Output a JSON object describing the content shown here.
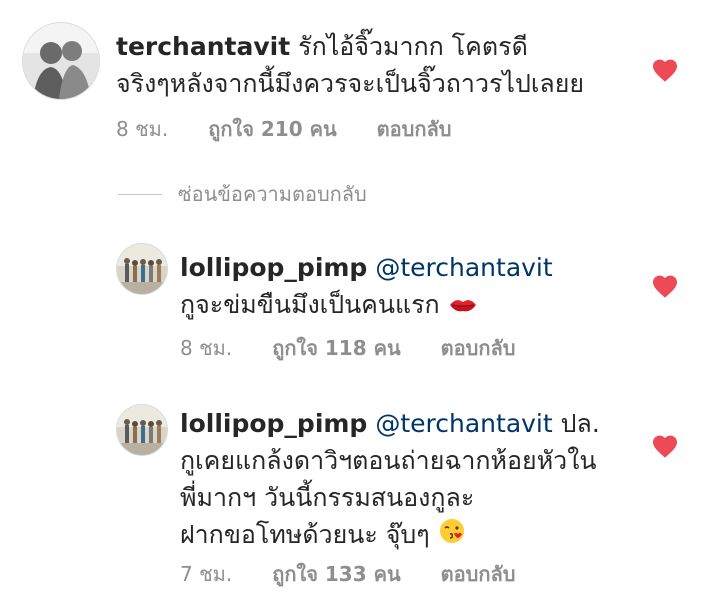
{
  "comments": [
    {
      "username": "terchantavit",
      "text_line1": "รักไอ้จิ๊วมากก โคตรดี",
      "text_line2": "จริงๆหลังจากนี้มึงควรจะเป็นจิ๊วถาวรไปเลยย",
      "time": "8 ชม.",
      "likes": "ถูกใจ 210 คน",
      "reply_label": "ตอบกลับ"
    },
    {
      "username": "lollipop_pimp",
      "mention": "@terchantavit",
      "text_line2": "กูจะข่มขืนมึงเป็นคนแรก",
      "emoji": "kiss-mark",
      "time": "8 ชม.",
      "likes": "ถูกใจ 118 คน",
      "reply_label": "ตอบกลับ"
    },
    {
      "username": "lollipop_pimp",
      "mention": "@terchantavit",
      "text_line1_tail": " ปล.",
      "text_line2": "กูเคยแกล้งดาวิฯตอนถ่ายฉากห้อยหัวใน",
      "text_line3": "พี่มากฯ วันนี้กรรมสนองกูละ",
      "text_line4": "ฝากขอโทษด้วยนะ จุ๊บๆ",
      "emoji": "face-blowing-kiss",
      "time": "7 ชม.",
      "likes": "ถูกใจ 133 คน",
      "reply_label": "ตอบกลับ"
    }
  ],
  "hide_replies_label": "ซ่อนข้อความตอบกลับ",
  "colors": {
    "heart": "#ed4956",
    "text": "#262626",
    "meta": "#8e8e8e",
    "mention": "#003569"
  },
  "icons": {
    "like": "heart-icon"
  }
}
